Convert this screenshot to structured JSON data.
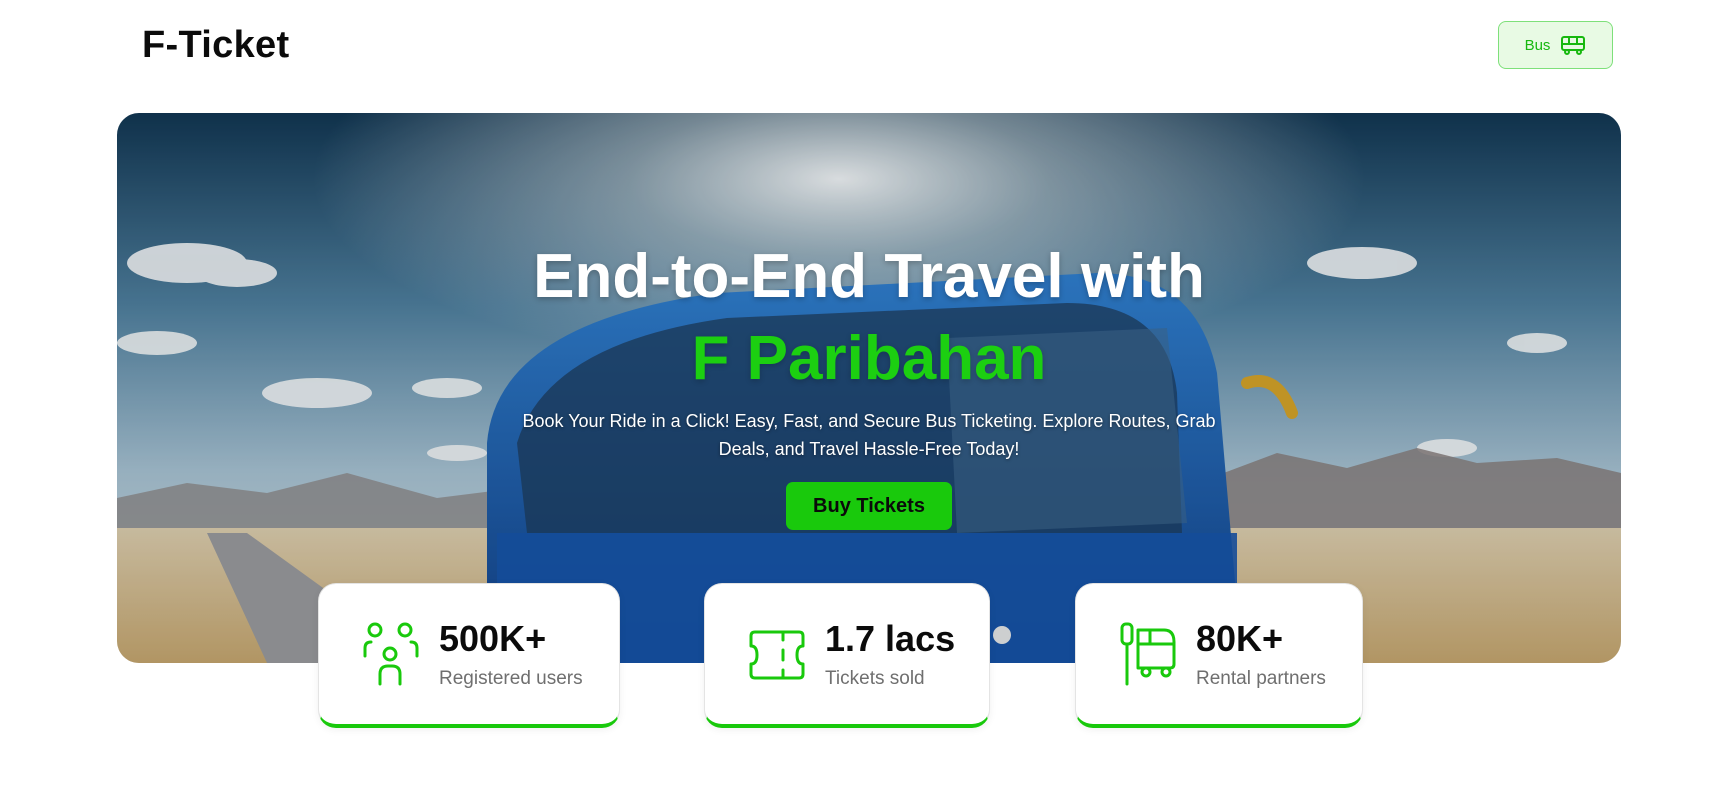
{
  "header": {
    "logo": "F-Ticket",
    "bus_button_label": "Bus",
    "bus_button_icon": "bus-icon"
  },
  "hero": {
    "title": "End-to-End Travel with",
    "accent": "F Paribahan",
    "subtitle": "Book Your Ride in a Click! Easy, Fast, and Secure Bus Ticketing. Explore Routes, Grab Deals, and Travel Hassle-Free Today!",
    "cta_label": "Buy Tickets"
  },
  "stats": [
    {
      "value": "500K+",
      "label": "Registered users",
      "icon": "users-icon"
    },
    {
      "value": "1.7 lacs",
      "label": "Tickets sold",
      "icon": "ticket-icon"
    },
    {
      "value": "80K+",
      "label": "Rental partners",
      "icon": "bus-stop-icon"
    }
  ],
  "colors": {
    "accent": "#19c90c",
    "accent_light": "#e8fae4",
    "text_dark": "#0b0b0b",
    "text_muted": "#6f6f6f"
  }
}
